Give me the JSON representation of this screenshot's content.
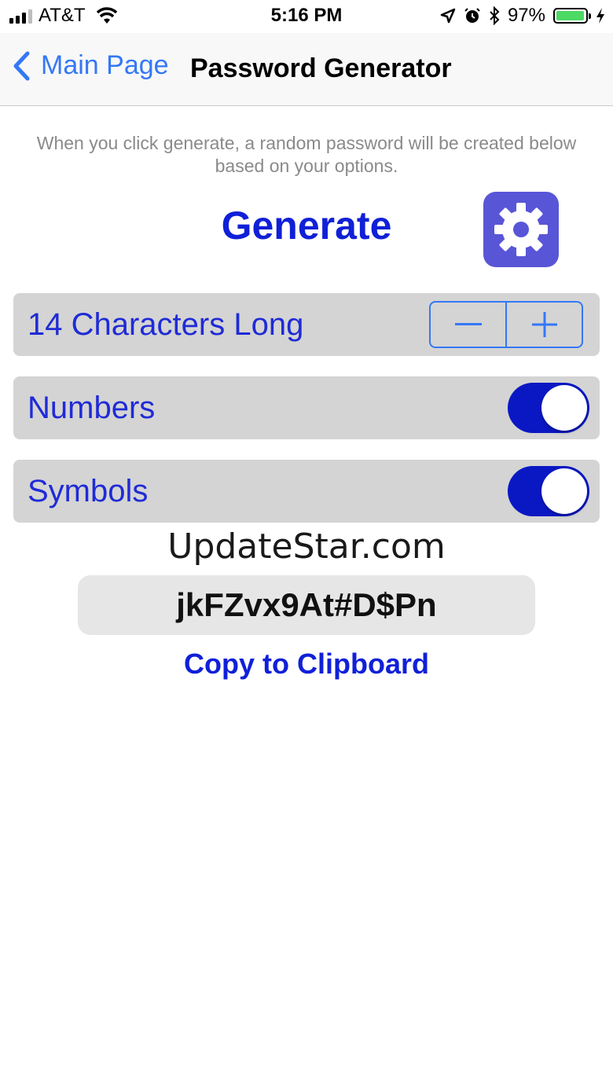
{
  "status_bar": {
    "carrier": "AT&T",
    "time": "5:16 PM",
    "battery_percent": "97%",
    "battery_level": 0.97,
    "icons": [
      "signal-icon",
      "wifi-icon",
      "location-icon",
      "alarm-icon",
      "bluetooth-icon",
      "battery-icon",
      "charging-icon"
    ]
  },
  "nav": {
    "back_label": "Main Page",
    "title": "Password Generator",
    "back_icon": "chevron-left-icon"
  },
  "description": "When you click generate, a random password will be created below based on your options.",
  "generate_label": "Generate",
  "settings_icon": "gear-icon",
  "options": {
    "length_label": "14 Characters Long",
    "length_value": 14,
    "numbers_label": "Numbers",
    "numbers_on": true,
    "symbols_label": "Symbols",
    "symbols_on": true
  },
  "watermark": "UpdateStar.com",
  "password": "jkFZvx9At#D$Pn",
  "copy_label": "Copy to Clipboard",
  "colors": {
    "accent": "#1020d8",
    "ios_blue": "#3478f6",
    "toggle_on": "#0a18c4",
    "settings_bg": "#5856d6",
    "row_bg": "#d4d4d4"
  }
}
